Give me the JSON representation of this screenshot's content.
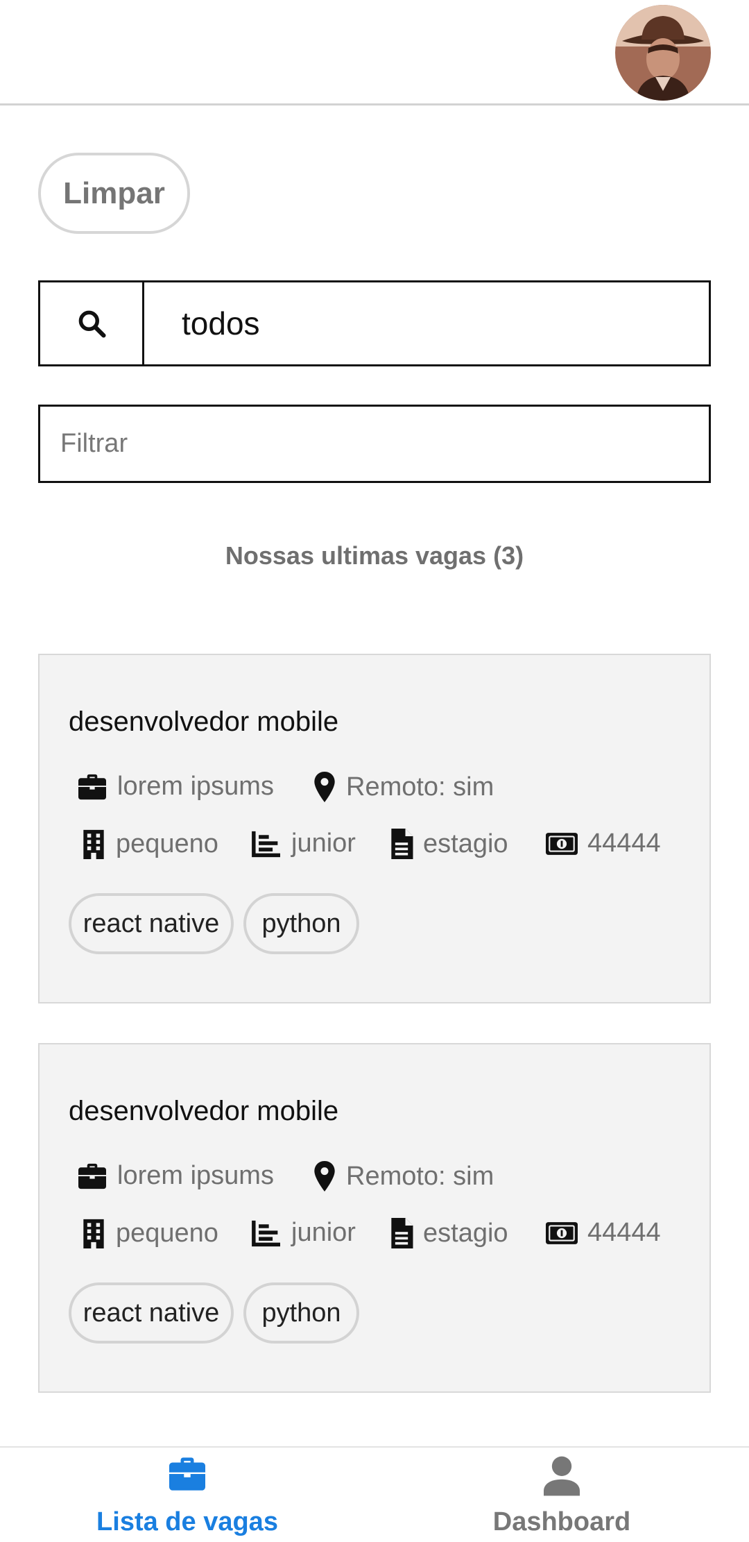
{
  "header": {
    "avatar_icon": "user-avatar-photo"
  },
  "actions": {
    "clear_label": "Limpar"
  },
  "search": {
    "icon": "search-icon",
    "value": "todos"
  },
  "filter": {
    "placeholder": "Filtrar"
  },
  "section": {
    "title": "Nossas ultimas vagas (3)"
  },
  "jobs": [
    {
      "title": "desenvolvedor mobile",
      "company": "lorem ipsums",
      "remote": "Remoto: sim",
      "size": "pequeno",
      "level": "junior",
      "contract": "estagio",
      "salary": "44444",
      "tags": [
        "react native",
        "python"
      ]
    },
    {
      "title": "desenvolvedor mobile",
      "company": "lorem ipsums",
      "remote": "Remoto: sim",
      "size": "pequeno",
      "level": "junior",
      "contract": "estagio",
      "salary": "44444",
      "tags": [
        "react native",
        "python"
      ]
    }
  ],
  "bottom_nav": {
    "items": [
      {
        "label": "Lista de vagas",
        "icon": "briefcase-icon",
        "active": true
      },
      {
        "label": "Dashboard",
        "icon": "person-icon",
        "active": false
      }
    ]
  },
  "colors": {
    "accent": "#1a7fe0",
    "inactive": "#777777",
    "card_bg": "#f3f3f3"
  }
}
